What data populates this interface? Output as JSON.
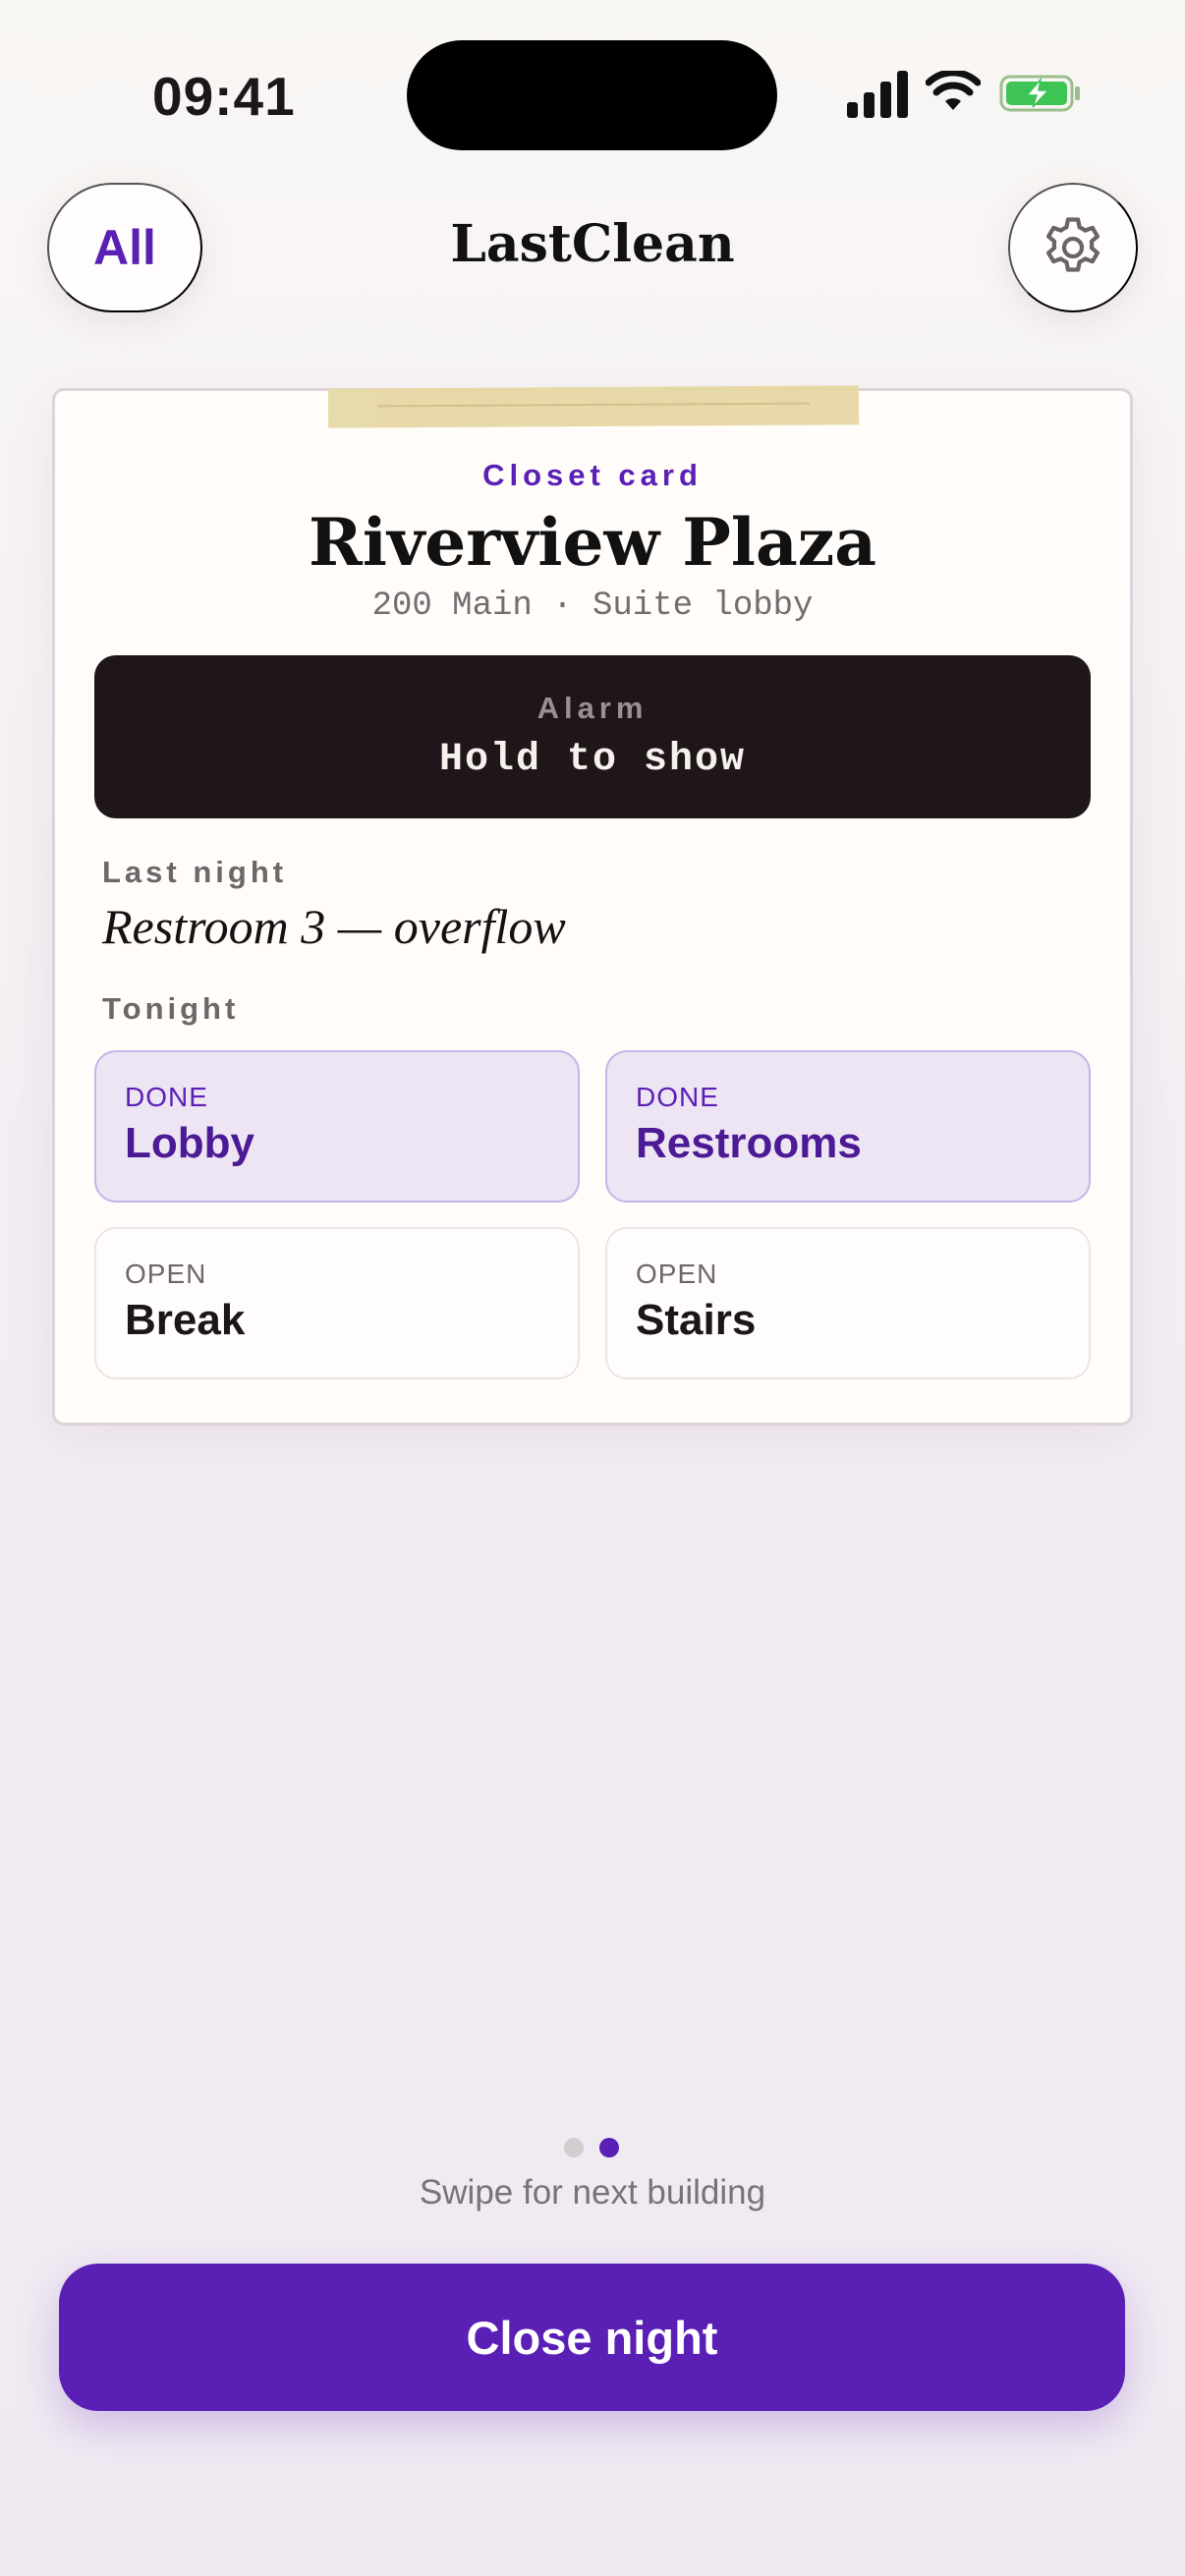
{
  "status_bar": {
    "time": "09:41"
  },
  "header": {
    "filter_label": "All",
    "title": "LastClean"
  },
  "card": {
    "eyebrow": "Closet card",
    "building_name": "Riverview Plaza",
    "address": "200 Main · Suite lobby",
    "alarm": {
      "label": "Alarm",
      "action": "Hold to show"
    },
    "last_night": {
      "label": "Last night",
      "value": "Restroom 3 — overflow"
    },
    "tonight": {
      "label": "Tonight",
      "tasks": [
        {
          "status": "DONE",
          "name": "Lobby"
        },
        {
          "status": "DONE",
          "name": "Restrooms"
        },
        {
          "status": "OPEN",
          "name": "Break"
        },
        {
          "status": "OPEN",
          "name": "Stairs"
        }
      ]
    }
  },
  "pager": {
    "total": 2,
    "current": 2
  },
  "swipe_hint": "Swipe for next building",
  "primary_action": "Close night",
  "colors": {
    "accent": "#5a1fb5",
    "alarm_background": "#1e1618",
    "done_tile": "#ede4f4",
    "tape": "#e6d9a4"
  }
}
